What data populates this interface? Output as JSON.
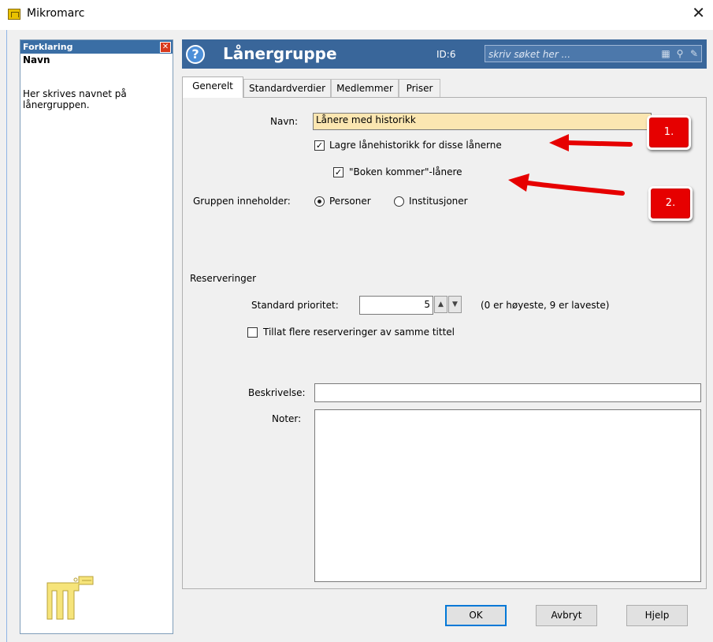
{
  "window": {
    "title": "Mikromarc",
    "close_glyph": "✕"
  },
  "help_pane": {
    "header": "Forklaring",
    "field_name": "Navn",
    "close_glyph": "✕",
    "description": "Her skrives navnet på lånergruppen."
  },
  "header": {
    "help_glyph": "?",
    "title": "Lånergruppe",
    "id_label": "ID:6",
    "search_placeholder": "skriv søket her ..."
  },
  "tabs": [
    "Generelt",
    "Standardverdier",
    "Medlemmer",
    "Priser"
  ],
  "form": {
    "name_label": "Navn:",
    "name_value": "Lånere med historikk",
    "history_checkbox_label": "Lagre lånehistorikk for disse lånerne",
    "history_checked": true,
    "boken_checkbox_label": "\"Boken kommer\"-lånere",
    "boken_checked": true,
    "contains_label": "Gruppen inneholder:",
    "radio_persons": "Personer",
    "radio_institutions": "Institusjoner",
    "selected_radio": "Personer",
    "reservations_heading": "Reserveringer",
    "priority_label": "Standard prioritet:",
    "priority_value": "5",
    "priority_hint": "(0 er høyeste, 9 er laveste)",
    "allow_multiple_label": "Tillat flere reserveringer av samme tittel",
    "allow_multiple_checked": false,
    "description_label": "Beskrivelse:",
    "description_value": "",
    "notes_label": "Noter:",
    "notes_value": ""
  },
  "buttons": {
    "ok": "OK",
    "cancel": "Avbryt",
    "help": "Hjelp"
  },
  "annotations": {
    "callout1": "1.",
    "callout2": "2.",
    "color": "#e60000"
  }
}
